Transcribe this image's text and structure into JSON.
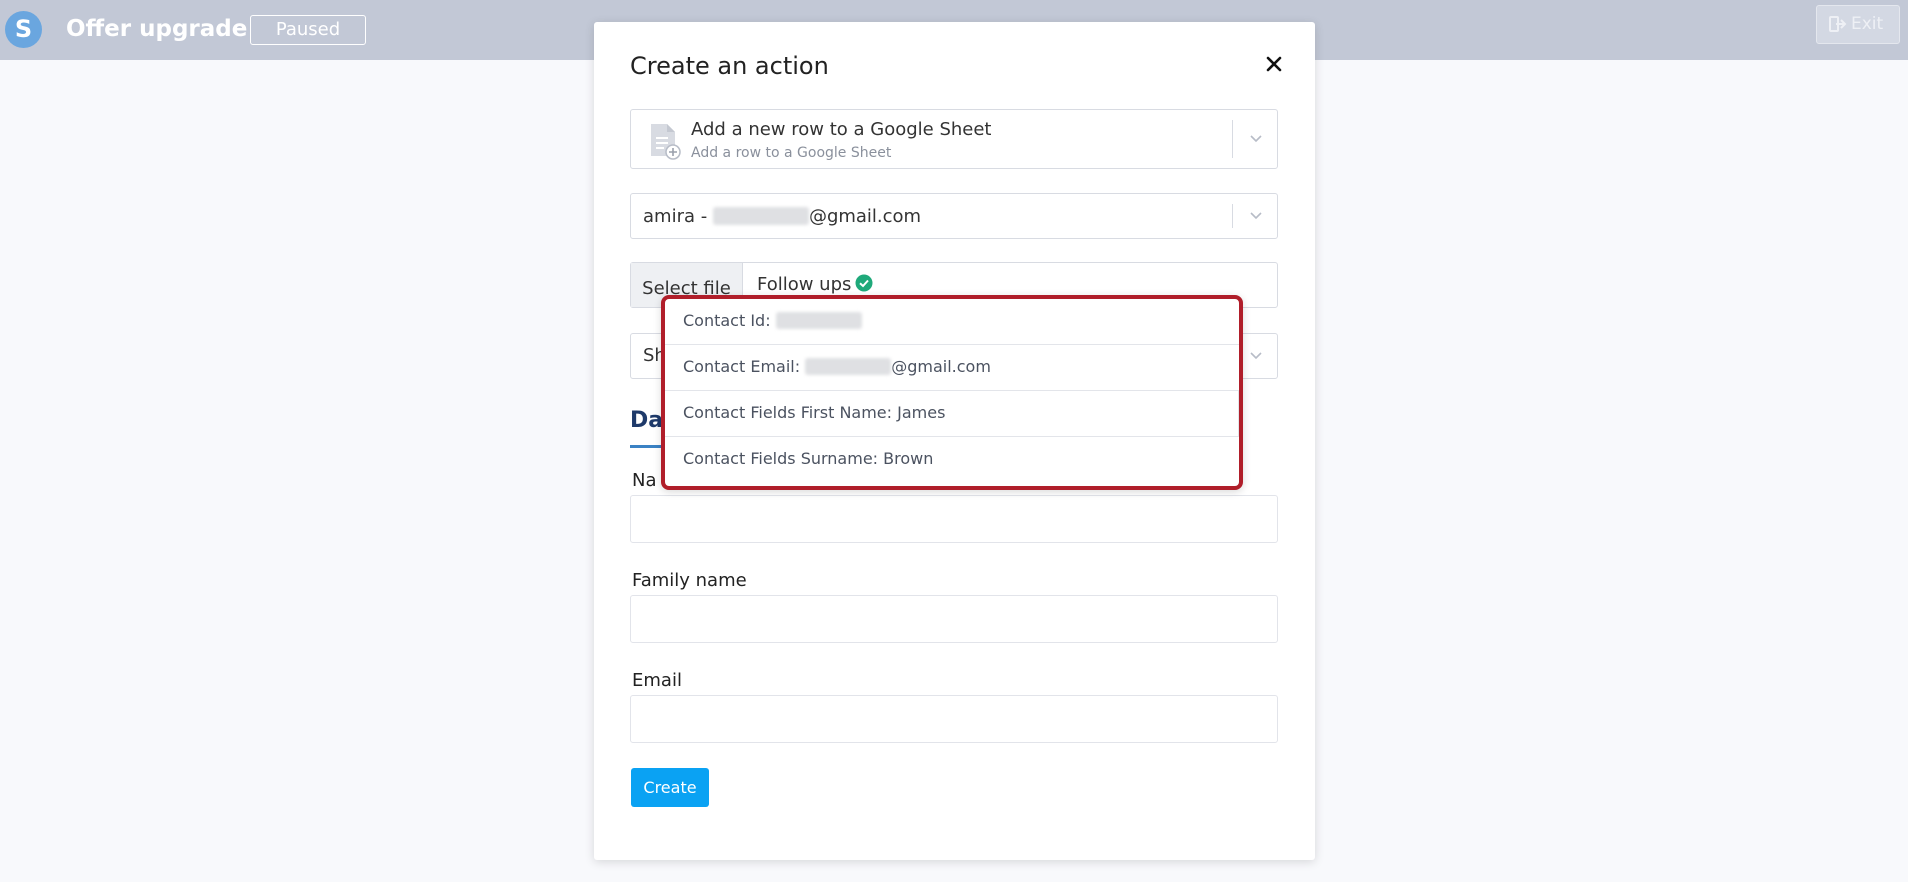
{
  "header": {
    "logo_letter": "S",
    "title": "Offer upgrade",
    "status": "Paused",
    "exit_label": "Exit"
  },
  "modal": {
    "title": "Create an action",
    "action": {
      "title": "Add a new row to a Google Sheet",
      "subtitle": "Add a row to a Google Sheet"
    },
    "account": {
      "prefix": "amira - ",
      "suffix": "@gmail.com"
    },
    "file": {
      "button_label": "Select file",
      "name": "Follow ups"
    },
    "sheet": {
      "value_partial": "Sh"
    },
    "tab": {
      "label_partial": "Da"
    },
    "fields": [
      {
        "label_partial": "Na",
        "value": ""
      },
      {
        "label": "Family name",
        "value": ""
      },
      {
        "label": "Email",
        "value": ""
      }
    ],
    "create_label": "Create"
  },
  "dropdown": {
    "items": [
      {
        "label": "Contact Id: ",
        "value_suffix": ""
      },
      {
        "label": "Contact Email: ",
        "value_suffix": "@gmail.com"
      },
      {
        "label": "Contact Fields First Name: James",
        "value_suffix": ""
      },
      {
        "label": "Contact Fields Surname: Brown",
        "value_suffix": ""
      }
    ]
  },
  "colors": {
    "topbar": "#c2c8d6",
    "primary": "#0aa2f3",
    "highlight_border": "#b01e2a",
    "success": "#1fa97a"
  },
  "icons": {
    "logo": "s-logo-icon",
    "exit": "exit-icon",
    "close": "close-icon",
    "action": "google-sheet-add-icon",
    "chevron": "chevron-down-icon",
    "check": "check-circle-icon"
  }
}
